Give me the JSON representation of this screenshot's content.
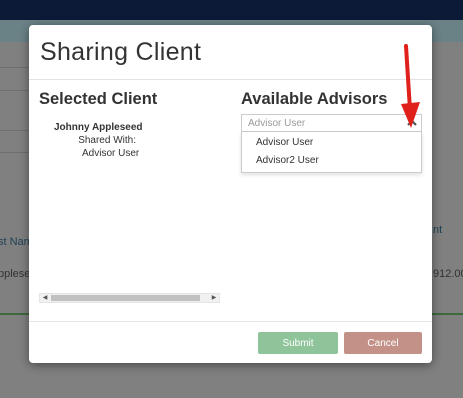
{
  "background": {
    "column_header_partial": "st Nam",
    "column_header_right_partial": "nt",
    "row_name_partial": "ppleseed",
    "row_amount_partial": "912.00"
  },
  "modal": {
    "title": "Sharing Client",
    "selected_client": {
      "heading": "Selected Client",
      "client_name": "Johnny Appleseed",
      "shared_with_label": "Shared With:",
      "shared_with_user": "Advisor User"
    },
    "available_advisors": {
      "heading": "Available Advisors",
      "select_placeholder": "Advisor User",
      "options": [
        "Advisor User",
        "Advisor2 User"
      ]
    },
    "buttons": {
      "submit": "Submit",
      "cancel": "Cancel"
    }
  },
  "colors": {
    "submit": "#8fc49a",
    "cancel": "#c49188",
    "annotation_arrow": "#e0201a"
  }
}
